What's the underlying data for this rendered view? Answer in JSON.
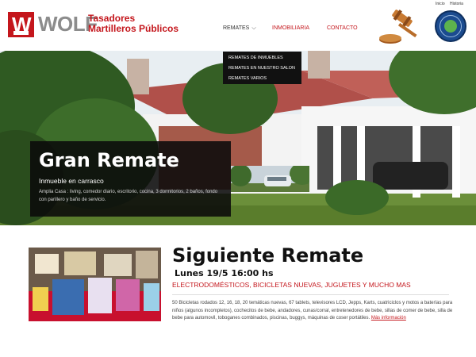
{
  "brand": {
    "logo_letter": "W",
    "name": "WOLF",
    "tagline_line1": "Tasadores",
    "tagline_line2": "Martilleros Públicos"
  },
  "top_links": {
    "inicio": "Inicio",
    "historia": "Historia"
  },
  "nav": {
    "remates": "REMATES",
    "inmobiliaria": "INMOBILIARIA",
    "contacto": "CONTACTO"
  },
  "dropdown": {
    "items": [
      "REMATES DE INMUEBLES",
      "REMATES EN NUESTRO SALON",
      "REMATES VARIOS"
    ]
  },
  "hero": {
    "title": "Gran Remate",
    "subtitle": "Inmueble en carrasco",
    "description": "Amplia Casa : living, comedor diario, escritorio, cocina, 3 dormitorios, 2 baños, fondo con parillero y baño de servicio."
  },
  "next_auction": {
    "title": "Siguiente Remate",
    "date": "Lunes 19/5 16:00 hs",
    "categories": "ELECTRODOMÉSTICOS, BICICLETAS NUEVAS, JUGUETES Y MUCHO MAS",
    "description": "50 Bicicletas rodados 12, 16, 18, 20 temáticas nuevas, 67 tablets, televisores LCD, Jepps, Karts, cuatriciclos y motos a baterías para niños (algunos incompletos), cochecitos de bebe, andadores, cunas/corral, entretenedores de bebe, sillas de comer de bebe, silla de bebe para automovil, toboganes combinados, piscinas, buggys, máquinas de coser portátiles.",
    "more_link": "Más información"
  },
  "colors": {
    "brand_red": "#c4161c",
    "caption_bg": "#0a0a0a",
    "dropdown_bg": "#111111"
  }
}
